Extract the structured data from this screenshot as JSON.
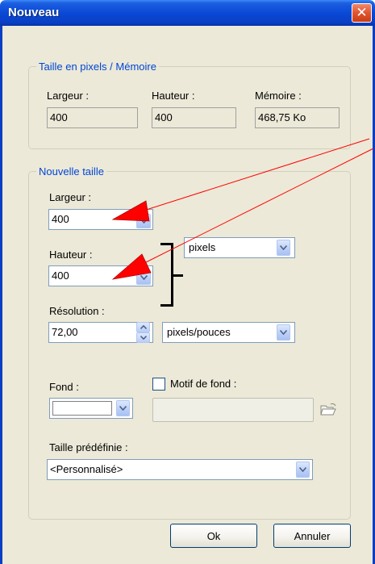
{
  "window": {
    "title": "Nouveau",
    "close_glyph": "✕"
  },
  "pixels_memory": {
    "group_label": "Taille en pixels / Mémoire",
    "largeur_label": "Largeur :",
    "largeur_value": "400",
    "hauteur_label": "Hauteur :",
    "hauteur_value": "400",
    "memoire_label": "Mémoire :",
    "memoire_value": "468,75 Ko"
  },
  "new_size": {
    "group_label": "Nouvelle taille",
    "largeur_label": "Largeur :",
    "largeur_value": "400",
    "hauteur_label": "Hauteur :",
    "hauteur_value": "400",
    "unit_value": "pixels",
    "resolution_label": "Résolution :",
    "resolution_value": "72,00",
    "resolution_unit_value": "pixels/pouces",
    "fond_label": "Fond :",
    "fond_color": "#ffffff",
    "motif_label": "Motif de fond :",
    "motif_checked": false,
    "preset_label": "Taille prédéfinie :",
    "preset_value": "<Personnalisé>"
  },
  "buttons": {
    "ok_label": "Ok",
    "cancel_label": "Annuler"
  },
  "colors": {
    "title_bar": "#0a49d6",
    "group_label": "#0046d5",
    "dialog_bg": "#ece9d8",
    "annotation_arrow": "#ff0000"
  }
}
